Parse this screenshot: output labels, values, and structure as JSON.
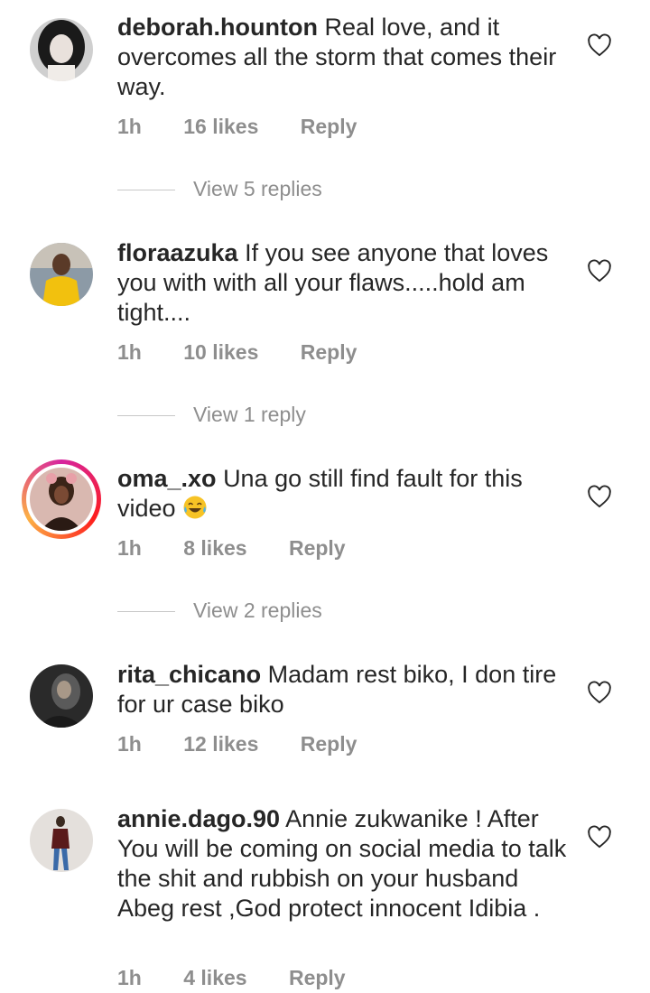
{
  "comments": [
    {
      "username": "deborah.hounton",
      "text": "Real  love, and it overcomes all the storm that comes their way.",
      "time": "1h",
      "likes": "16 likes",
      "reply": "Reply",
      "view_replies": "View 5 replies"
    },
    {
      "username": "floraazuka",
      "text": "If you see anyone that loves you with with all your flaws.....hold am tight....",
      "time": "1h",
      "likes": "10 likes",
      "reply": "Reply",
      "view_replies": "View 1 reply"
    },
    {
      "username": "oma_.xo",
      "text": "Una go still find fault for this video",
      "emoji": "face-with-tears-of-joy",
      "time": "1h",
      "likes": "8 likes",
      "reply": "Reply",
      "view_replies": "View 2 replies"
    },
    {
      "username": "rita_chicano",
      "text": "Madam rest biko, I don tire for ur case biko",
      "time": "1h",
      "likes": "12 likes",
      "reply": "Reply"
    },
    {
      "username": "annie.dago.90",
      "text": "Annie zukwanike ! After You will be coming on social media to talk the shit and rubbish on your husband Abeg rest ,God protect innocent Idibia .",
      "time": "1h",
      "likes": "4 likes",
      "reply": "Reply"
    }
  ],
  "icons": {
    "like": "heart-outline-icon",
    "story_ring_colors": [
      "#d6249f",
      "#fd1d1d",
      "#fcb045"
    ]
  }
}
